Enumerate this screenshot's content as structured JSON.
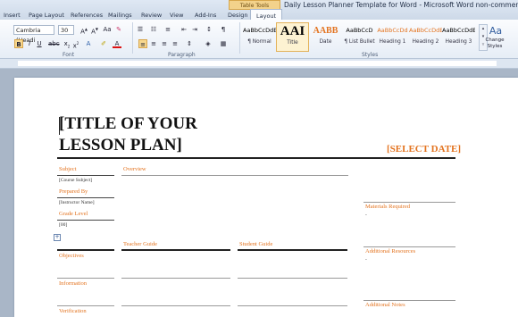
{
  "window": {
    "title": "Daily Lesson Planner Template for Word - Microsoft Word non-commerci..."
  },
  "ribbon_tabs": [
    "Insert",
    "Page Layout",
    "References",
    "Mailings",
    "Review",
    "View",
    "Add-Ins",
    "Design",
    "Layout"
  ],
  "contextual_tab": "Table Tools",
  "font": {
    "name": "Cambria (Headi",
    "size": "30",
    "group_label": "Font"
  },
  "paragraph": {
    "group_label": "Paragraph"
  },
  "styles": {
    "group_label": "Styles",
    "items": [
      {
        "preview": "AaBbCcDdE",
        "name": "¶ Normal"
      },
      {
        "preview": "AAI",
        "name": "Title"
      },
      {
        "preview": "AABB",
        "name": "Date"
      },
      {
        "preview": "AaBbCcD",
        "name": "¶ List Bullet"
      },
      {
        "preview": "AaBbCcDd",
        "name": "Heading 1"
      },
      {
        "preview": "AaBbCcDdE",
        "name": "Heading 2"
      },
      {
        "preview": "AaBbCcDdE",
        "name": "Heading 3"
      }
    ],
    "change_styles": "Change Styles"
  },
  "document": {
    "title_line1": "[TITLE OF YOUR",
    "title_line2": "LESSON PLAN]",
    "select_date": "[SELECT DATE]",
    "subject_label": "Subject",
    "subject_value": "[Course Subject]",
    "prepared_label": "Prepared By",
    "prepared_value": "[Instructor Name]",
    "grade_label": "Grade Level",
    "grade_value": "[00]",
    "overview_label": "Overview",
    "materials_label": "Materials Required",
    "materials_value": "-",
    "teacher_guide_label": "Teacher Guide",
    "student_guide_label": "Student Guide",
    "objectives_label": "Objectives",
    "additional_resources_label": "Additional Resources",
    "additional_resources_value": "-",
    "information_label": "Information",
    "additional_notes_label": "Additional Notes",
    "verification_label": "Verification"
  }
}
